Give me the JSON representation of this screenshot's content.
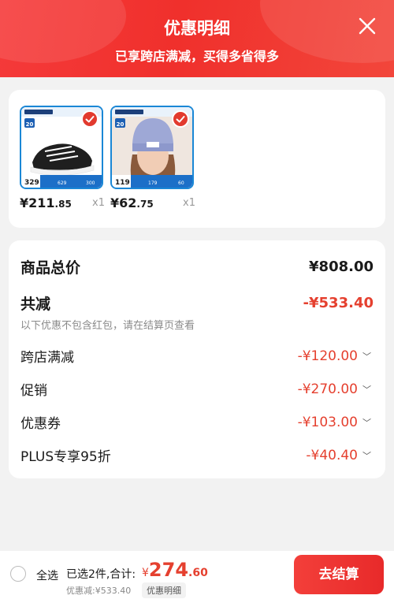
{
  "header": {
    "title": "优惠明细",
    "subtitle": "已享跨店满减，买得多省得多",
    "close_icon": "close-icon"
  },
  "products": [
    {
      "name": "sneaker",
      "price_int": "¥211",
      "price_dec": ".85",
      "qty": "x1",
      "thumb_badge": "20",
      "thumb_price": "329",
      "thumb_nums": [
        "629",
        "300"
      ]
    },
    {
      "name": "beanie",
      "price_int": "¥62",
      "price_dec": ".75",
      "qty": "x1",
      "thumb_badge": "20",
      "thumb_price": "119",
      "thumb_nums": [
        "179",
        "60"
      ]
    }
  ],
  "summary": {
    "total_label": "商品总价",
    "total_value": "¥808.00",
    "discount_label": "共减",
    "discount_value": "-¥533.40",
    "note": "以下优惠不包含红包，请在结算页查看",
    "items": [
      {
        "label": "跨店满减",
        "value": "-¥120.00"
      },
      {
        "label": "促销",
        "value": "-¥270.00"
      },
      {
        "label": "优惠券",
        "value": "-¥103.00"
      },
      {
        "label": "PLUS专享95折",
        "value": "-¥40.40"
      }
    ]
  },
  "bottom": {
    "select_all": "全选",
    "selected_count": "已选2件,合计:",
    "total_currency": "¥",
    "total_int": "274",
    "total_dec": ".60",
    "discount_line": "优惠减:¥533.40",
    "detail_link": "优惠明细",
    "checkout": "去结算"
  },
  "colors": {
    "header_red": "#f0302c",
    "accent_red": "#e5402f",
    "thumb_border_blue": "#1a87d6"
  }
}
